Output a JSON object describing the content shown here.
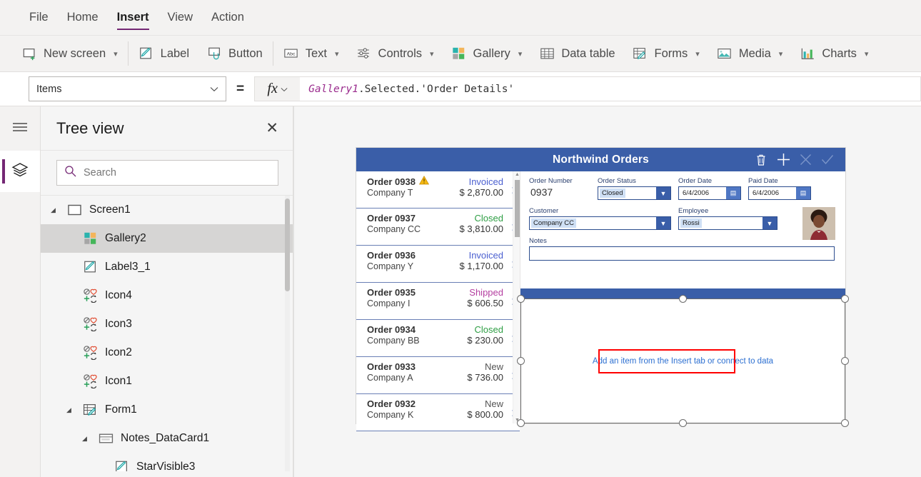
{
  "menu": {
    "items": [
      {
        "label": "File",
        "active": false
      },
      {
        "label": "Home",
        "active": false
      },
      {
        "label": "Insert",
        "active": true
      },
      {
        "label": "View",
        "active": false
      },
      {
        "label": "Action",
        "active": false
      }
    ]
  },
  "ribbon": {
    "items": [
      {
        "label": "New screen",
        "icon": "new-screen-icon",
        "chevron": true
      },
      {
        "label": "Label",
        "icon": "label-icon",
        "chevron": false
      },
      {
        "label": "Button",
        "icon": "button-icon",
        "chevron": false
      },
      {
        "label": "Text",
        "icon": "text-abc-icon",
        "chevron": true
      },
      {
        "label": "Controls",
        "icon": "controls-sliders-icon",
        "chevron": true
      },
      {
        "label": "Gallery",
        "icon": "gallery-squares-icon",
        "chevron": true
      },
      {
        "label": "Data table",
        "icon": "data-table-icon",
        "chevron": false
      },
      {
        "label": "Forms",
        "icon": "forms-icon",
        "chevron": true
      },
      {
        "label": "Media",
        "icon": "media-image-icon",
        "chevron": true
      },
      {
        "label": "Charts",
        "icon": "charts-bar-icon",
        "chevron": true
      }
    ]
  },
  "formula_bar": {
    "property": "Items",
    "equals": "=",
    "fx_label": "fx",
    "formula_control": "Gallery1",
    "formula_rest": ".Selected.'Order Details'"
  },
  "tree_view": {
    "title": "Tree view",
    "close_label": "✕",
    "search_placeholder": "Search",
    "nodes": [
      {
        "label": "Screen1",
        "indent": 0,
        "caret": "▾",
        "icon": "screen-icon",
        "selected": false
      },
      {
        "label": "Gallery2",
        "indent": 1,
        "caret": "",
        "icon": "gallery-squares-icon",
        "selected": true
      },
      {
        "label": "Label3_1",
        "indent": 1,
        "caret": "",
        "icon": "label-icon",
        "selected": false
      },
      {
        "label": "Icon4",
        "indent": 1,
        "caret": "",
        "icon": "icons-group-icon",
        "selected": false
      },
      {
        "label": "Icon3",
        "indent": 1,
        "caret": "",
        "icon": "icons-group-icon",
        "selected": false
      },
      {
        "label": "Icon2",
        "indent": 1,
        "caret": "",
        "icon": "icons-group-icon",
        "selected": false
      },
      {
        "label": "Icon1",
        "indent": 1,
        "caret": "",
        "icon": "icons-group-icon",
        "selected": false
      },
      {
        "label": "Form1",
        "indent": 1,
        "caret": "▾",
        "icon": "form-icon",
        "selected": false
      },
      {
        "label": "Notes_DataCard1",
        "indent": 2,
        "caret": "▾",
        "icon": "datacard-icon",
        "selected": false
      },
      {
        "label": "StarVisible3",
        "indent": 3,
        "caret": "",
        "icon": "label-icon",
        "selected": false
      }
    ]
  },
  "app_preview": {
    "header": {
      "title": "Northwind Orders",
      "actions": [
        {
          "name": "delete-icon",
          "glyph": "trash",
          "dimmed": false
        },
        {
          "name": "add-icon",
          "glyph": "plus",
          "dimmed": false
        },
        {
          "name": "cancel-icon",
          "glyph": "cross",
          "dimmed": true
        },
        {
          "name": "confirm-icon",
          "glyph": "check",
          "dimmed": true
        }
      ]
    },
    "orders": [
      {
        "order": "Order 0938",
        "warning": true,
        "status": "Invoiced",
        "status_color": "#4a5fd0",
        "company": "Company T",
        "amount": "$ 2,870.00"
      },
      {
        "order": "Order 0937",
        "warning": false,
        "status": "Closed",
        "status_color": "#2e9e44",
        "company": "Company CC",
        "amount": "$ 3,810.00"
      },
      {
        "order": "Order 0936",
        "warning": false,
        "status": "Invoiced",
        "status_color": "#4a5fd0",
        "company": "Company Y",
        "amount": "$ 1,170.00"
      },
      {
        "order": "Order 0935",
        "warning": false,
        "status": "Shipped",
        "status_color": "#b43fa0",
        "company": "Company I",
        "amount": "$ 606.50"
      },
      {
        "order": "Order 0934",
        "warning": false,
        "status": "Closed",
        "status_color": "#2e9e44",
        "company": "Company BB",
        "amount": "$ 230.00"
      },
      {
        "order": "Order 0933",
        "warning": false,
        "status": "New",
        "status_color": "#555555",
        "company": "Company A",
        "amount": "$ 736.00"
      },
      {
        "order": "Order 0932",
        "warning": false,
        "status": "New",
        "status_color": "#555555",
        "company": "Company K",
        "amount": "$ 800.00"
      }
    ],
    "form": {
      "order_number_label": "Order Number",
      "order_number_value": "0937",
      "order_status_label": "Order Status",
      "order_status_value": "Closed",
      "order_date_label": "Order Date",
      "order_date_value": "6/4/2006",
      "paid_date_label": "Paid Date",
      "paid_date_value": "6/4/2006",
      "customer_label": "Customer",
      "customer_value": "Company CC",
      "employee_label": "Employee",
      "employee_value": "Rossi",
      "notes_label": "Notes",
      "notes_value": ""
    },
    "selected_gallery": {
      "empty_message": "Add an item from the Insert tab or connect to data",
      "annotation_color": "#ff0000"
    }
  },
  "colors": {
    "accent_purple": "#742774",
    "app_blue": "#3a5ea8",
    "link_blue": "#2c6fd1",
    "chrome_gray": "#f3f2f1"
  }
}
